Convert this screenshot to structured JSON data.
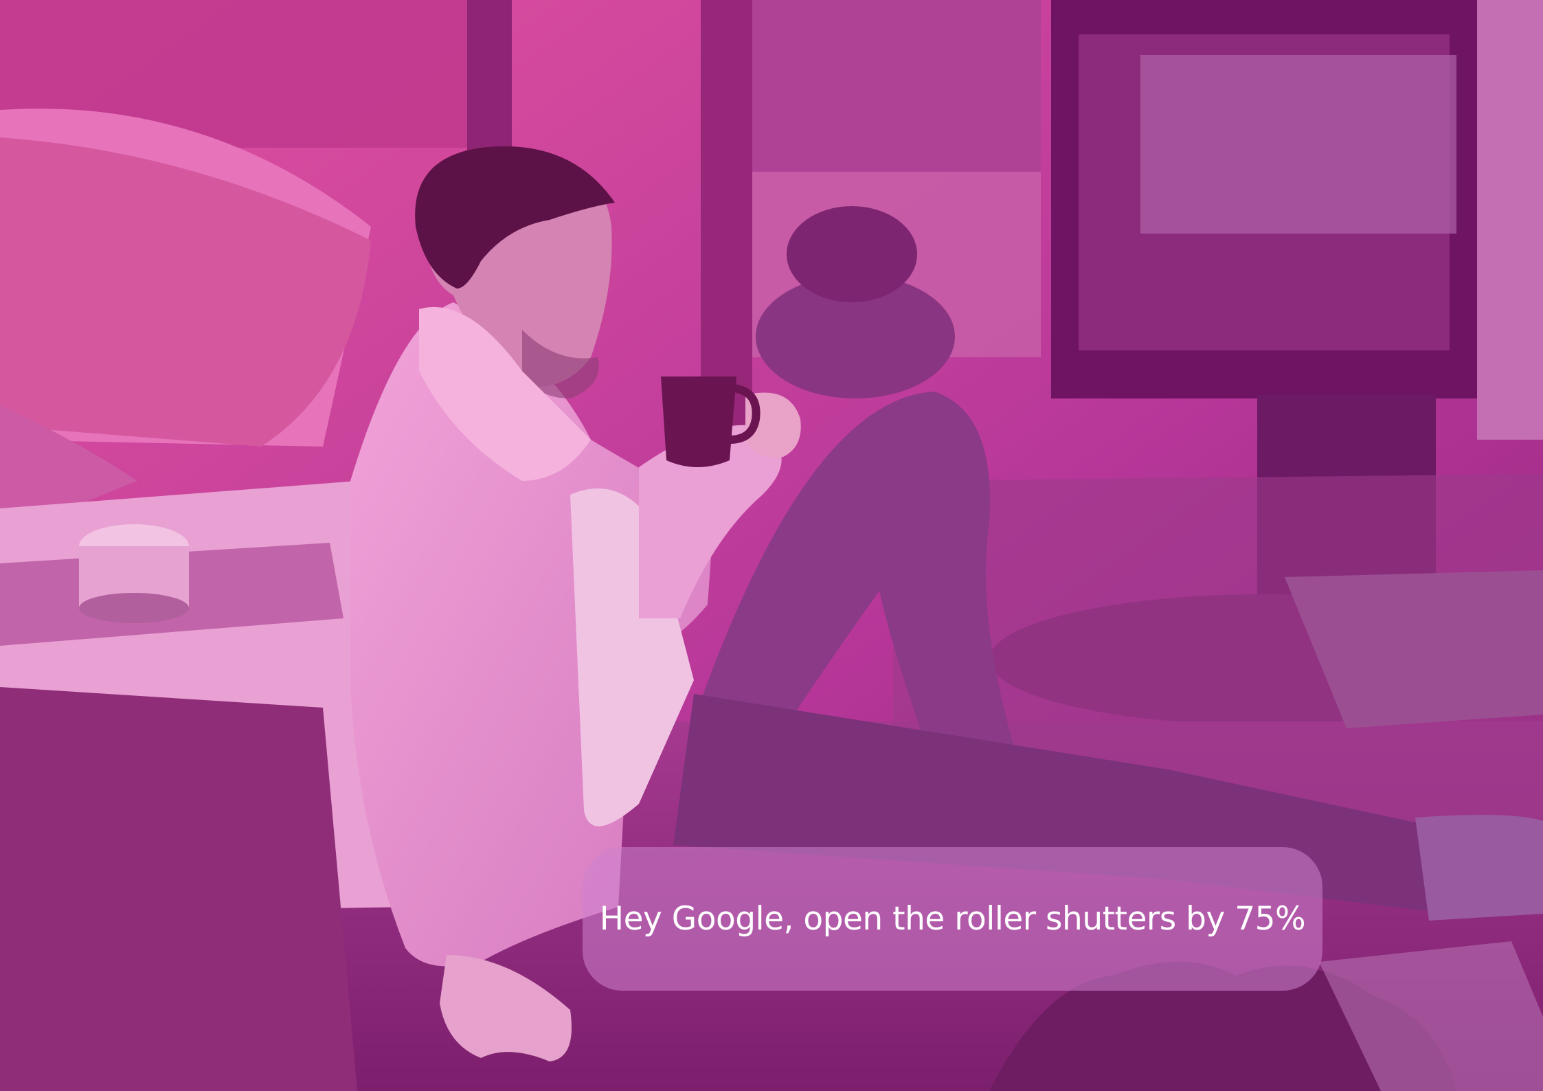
{
  "overlay": {
    "tint_top_left": "#e0509e",
    "tint_bottom_right": "#8e1f78"
  },
  "caption": {
    "text": "Hey Google, open the roller shutters by 75%"
  }
}
